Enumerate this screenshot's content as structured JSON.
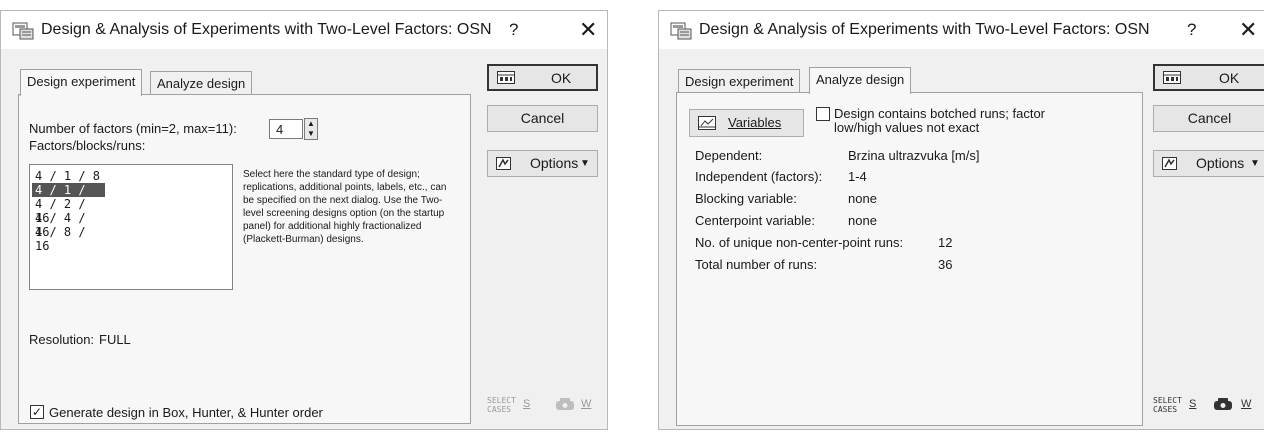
{
  "dialog_left": {
    "title": "Design & Analysis of Experiments with Two-Level Factors: OSN",
    "help": "?",
    "close": "✕",
    "tabs": [
      "Design experiment",
      "Analyze design"
    ],
    "num_factors_label": "Number of factors (min=2, max=11):",
    "num_factors_value": "4",
    "factors_list_label": "Factors/blocks/runs:",
    "design_options": [
      "4 / 1 / 8",
      "4 / 1 / 16",
      "4 / 2 / 16",
      "4 / 4 / 16",
      "4 / 8 / 16"
    ],
    "selected_option": "4 / 1 / 16",
    "note": "Select here the standard type of design; replications, additional points, labels, etc., can be specified on the next dialog. Use the Two-level screening designs option (on the startup panel) for additional highly fractionalized (Plackett-Burman) designs.",
    "resolution_label": "Resolution:",
    "resolution_value": "FULL",
    "generate_checkbox_label": "Generate design in Box, Hunter, & Hunter order",
    "generate_checked": true,
    "buttons": {
      "ok": "OK",
      "cancel": "Cancel",
      "options": "Options"
    },
    "select_cases": {
      "line1": "SELECT",
      "line2": "CASES",
      "key": "S"
    },
    "weight": {
      "key": "W"
    }
  },
  "dialog_right": {
    "title": "Design & Analysis of Experiments with Two-Level Factors: OSN",
    "help": "?",
    "close": "✕",
    "tabs": [
      "Design experiment",
      "Analyze design"
    ],
    "variables_button": "Variables",
    "botched_checkbox_label_1": "Design contains botched runs; factor",
    "botched_checkbox_label_2": "low/high values not exact",
    "botched_checked": false,
    "rows": [
      {
        "label": "Dependent:",
        "value": "Brzina ultrazvuka [m/s]"
      },
      {
        "label": "Independent (factors):",
        "value": "1-4"
      },
      {
        "label": "Blocking variable:",
        "value": "none"
      },
      {
        "label": "Centerpoint variable:",
        "value": "none"
      },
      {
        "label": "No. of unique non-center-point runs:",
        "value": "12"
      },
      {
        "label": "Total number of runs:",
        "value": "36"
      }
    ],
    "buttons": {
      "ok": "OK",
      "cancel": "Cancel",
      "options": "Options"
    },
    "select_cases": {
      "line1": "SELECT",
      "line2": "CASES",
      "key": "S"
    },
    "weight": {
      "key": "W"
    }
  }
}
